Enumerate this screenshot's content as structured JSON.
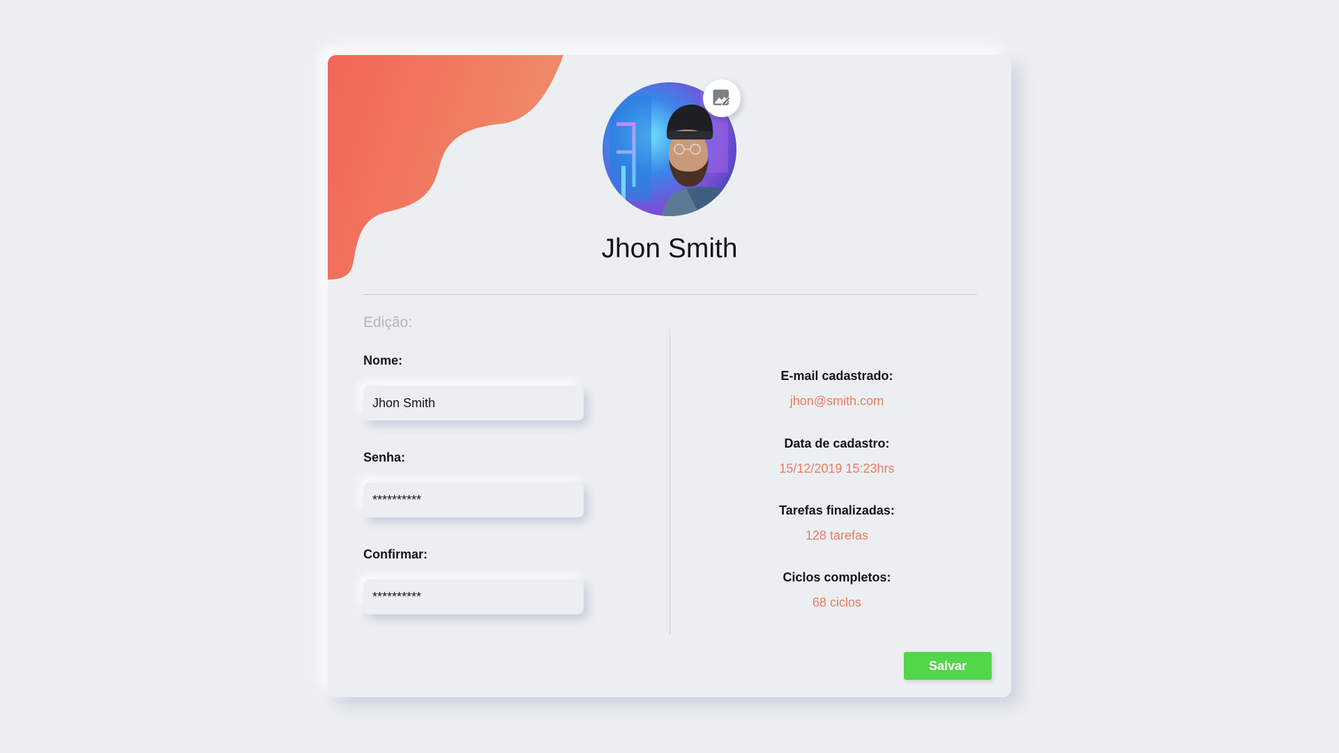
{
  "profile": {
    "name": "Jhon Smith",
    "avatar_alt": "avatar",
    "edit_photo_icon": "edit-image-icon"
  },
  "form": {
    "section_title": "Edição:",
    "name_label": "Nome:",
    "name_value": "Jhon Smith",
    "password_label": "Senha:",
    "password_value": "**********",
    "confirm_label": "Confirmar:",
    "confirm_value": "**********"
  },
  "details": {
    "email_label": "E-mail cadastrado:",
    "email_value": "jhon@smith.com",
    "date_label": "Data de cadastro:",
    "date_value": "15/12/2019 15:23hrs",
    "tasks_label": "Tarefas finalizadas:",
    "tasks_value": "128 tarefas",
    "cycles_label": "Ciclos completos:",
    "cycles_value": "68 ciclos"
  },
  "actions": {
    "save_label": "Salvar"
  },
  "colors": {
    "background": "#eceff2",
    "accent": "#ee7a60",
    "blob_start": "#f26a5a",
    "blob_end": "#ef8a68",
    "save_button": "#52d64a"
  }
}
